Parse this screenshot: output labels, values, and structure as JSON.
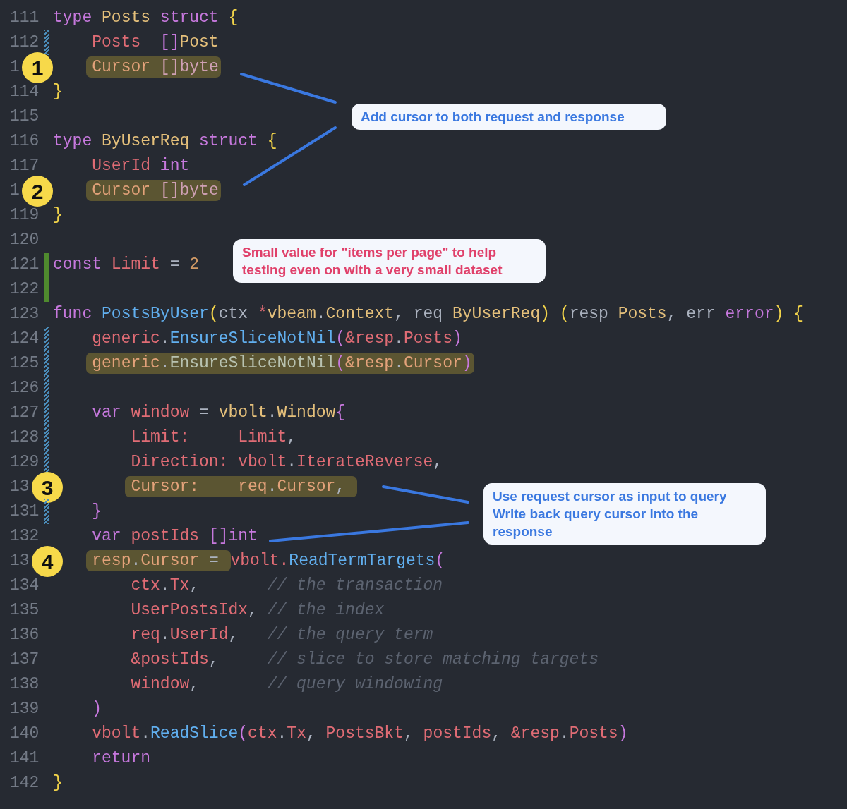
{
  "editor": {
    "lines": [
      {
        "number": "111",
        "modified": false,
        "added": false,
        "before": [
          {
            "t": "type",
            "kind": "kw"
          },
          {
            "t": " Posts",
            "kind": "type"
          },
          {
            "t": " struct",
            "kind": "kw"
          },
          {
            "t": " {",
            "kind": "brace"
          }
        ]
      },
      {
        "number": "112",
        "modified": true,
        "added": false,
        "before": [
          {
            "t": "    Posts",
            "kind": "field"
          },
          {
            "t": "  []",
            "kind": "kw"
          },
          {
            "t": "Post",
            "kind": "type"
          }
        ]
      },
      {
        "number": "1",
        "modified": false,
        "added": false,
        "badge": "1",
        "highlight": [
          {
            "t": "    Cursor",
            "kind": "field"
          },
          {
            "t": " []",
            "kind": "kw"
          },
          {
            "t": "byte",
            "kind": "kw"
          }
        ]
      },
      {
        "number": "114",
        "modified": false,
        "added": false,
        "before": [
          {
            "t": "}",
            "kind": "brace"
          }
        ]
      },
      {
        "number": "115",
        "modified": false,
        "added": false
      },
      {
        "number": "116",
        "modified": false,
        "added": false,
        "before": [
          {
            "t": "type",
            "kind": "kw"
          },
          {
            "t": " ByUserReq",
            "kind": "type"
          },
          {
            "t": " struct",
            "kind": "kw"
          },
          {
            "t": " {",
            "kind": "brace"
          }
        ]
      },
      {
        "number": "117",
        "modified": false,
        "added": false,
        "before": [
          {
            "t": "    UserId",
            "kind": "field"
          },
          {
            "t": " int",
            "kind": "kw"
          }
        ]
      },
      {
        "number": "1",
        "modified": false,
        "added": false,
        "badge": "2",
        "highlight": [
          {
            "t": "    Cursor",
            "kind": "field"
          },
          {
            "t": " []",
            "kind": "kw"
          },
          {
            "t": "byte",
            "kind": "kw"
          }
        ]
      },
      {
        "number": "119",
        "modified": false,
        "added": false,
        "before": [
          {
            "t": "}",
            "kind": "brace"
          }
        ]
      },
      {
        "number": "120",
        "modified": false,
        "added": false
      },
      {
        "number": "121",
        "modified": false,
        "added": true,
        "before": [
          {
            "t": "const",
            "kind": "kw"
          },
          {
            "t": " Limit",
            "kind": "field"
          },
          {
            "t": " = "
          },
          {
            "t": "2",
            "kind": "num"
          }
        ]
      },
      {
        "number": "122",
        "modified": false,
        "added": true
      },
      {
        "number": "123",
        "modified": false,
        "added": false,
        "before": [
          {
            "t": "func",
            "kind": "kw"
          },
          {
            "t": " PostsByUser",
            "kind": "fn"
          },
          {
            "t": "(",
            "kind": "brace"
          },
          {
            "t": "ctx "
          },
          {
            "t": "*",
            "kind": "field"
          },
          {
            "t": "vbeam",
            "kind": "type"
          },
          {
            "t": "."
          },
          {
            "t": "Context",
            "kind": "type"
          },
          {
            "t": ", req "
          },
          {
            "t": "ByUserReq",
            "kind": "type"
          },
          {
            "t": ")",
            "kind": "brace"
          },
          {
            "t": " (",
            "kind": "brace"
          },
          {
            "t": "resp "
          },
          {
            "t": "Posts",
            "kind": "type"
          },
          {
            "t": ", err "
          },
          {
            "t": "error",
            "kind": "kw"
          },
          {
            "t": ")",
            "kind": "brace"
          },
          {
            "t": " {",
            "kind": "brace"
          }
        ]
      },
      {
        "number": "124",
        "modified": true,
        "added": false,
        "before": [
          {
            "t": "    generic",
            "kind": "field"
          },
          {
            "t": "."
          },
          {
            "t": "EnsureSliceNotNil",
            "kind": "fn"
          },
          {
            "t": "(",
            "kind": "paren"
          },
          {
            "t": "&resp",
            "kind": "field"
          },
          {
            "t": "."
          },
          {
            "t": "Posts",
            "kind": "field"
          },
          {
            "t": ")",
            "kind": "paren"
          }
        ]
      },
      {
        "number": "125",
        "modified": true,
        "added": false,
        "highlight": [
          {
            "t": "    generic",
            "kind": "field"
          },
          {
            "t": "."
          },
          {
            "t": "EnsureSliceNotNil",
            "kind": "fn"
          },
          {
            "t": "(",
            "kind": "paren"
          },
          {
            "t": "&resp",
            "kind": "field"
          },
          {
            "t": "."
          },
          {
            "t": "Cursor",
            "kind": "field"
          },
          {
            "t": ")",
            "kind": "paren"
          }
        ]
      },
      {
        "number": "126",
        "modified": true,
        "added": false
      },
      {
        "number": "127",
        "modified": true,
        "added": false,
        "before": [
          {
            "t": "    var",
            "kind": "kw"
          },
          {
            "t": " window",
            "kind": "field"
          },
          {
            "t": " = "
          },
          {
            "t": "vbolt",
            "kind": "type"
          },
          {
            "t": "."
          },
          {
            "t": "Window",
            "kind": "type"
          },
          {
            "t": "{",
            "kind": "paren"
          }
        ]
      },
      {
        "number": "128",
        "modified": true,
        "added": false,
        "before": [
          {
            "t": "        Limit:",
            "kind": "field"
          },
          {
            "t": "     Limit",
            "kind": "field"
          },
          {
            "t": ","
          }
        ]
      },
      {
        "number": "129",
        "modified": true,
        "added": false,
        "before": [
          {
            "t": "        Direction:",
            "kind": "field"
          },
          {
            "t": " vbolt",
            "kind": "field"
          },
          {
            "t": "."
          },
          {
            "t": "IterateReverse",
            "kind": "field"
          },
          {
            "t": ","
          }
        ]
      },
      {
        "number": "13",
        "modified": false,
        "added": false,
        "badge": "3",
        "highlight": [
          {
            "t": "        Cursor:",
            "kind": "field"
          },
          {
            "t": "    req",
            "kind": "field"
          },
          {
            "t": "."
          },
          {
            "t": "Cursor",
            "kind": "field"
          },
          {
            "t": ", "
          }
        ]
      },
      {
        "number": "131",
        "modified": true,
        "added": false,
        "before": [
          {
            "t": "    }",
            "kind": "paren"
          }
        ]
      },
      {
        "number": "132",
        "modified": false,
        "added": false,
        "before": [
          {
            "t": "    var",
            "kind": "kw"
          },
          {
            "t": " postIds",
            "kind": "field"
          },
          {
            "t": " []",
            "kind": "kw"
          },
          {
            "t": "int",
            "kind": "kw"
          }
        ]
      },
      {
        "number": "13",
        "modified": false,
        "added": false,
        "badge": "4",
        "highlight": [
          {
            "t": "    resp",
            "kind": "field"
          },
          {
            "t": "."
          },
          {
            "t": "Cursor",
            "kind": "field"
          },
          {
            "t": " = "
          }
        ],
        "after": [
          {
            "t": "vbolt.",
            "kind": "field"
          },
          {
            "t": "ReadTermTargets",
            "kind": "fn"
          },
          {
            "t": "(",
            "kind": "paren"
          }
        ]
      },
      {
        "number": "134",
        "modified": false,
        "added": false,
        "before": [
          {
            "t": "        ctx",
            "kind": "field"
          },
          {
            "t": "."
          },
          {
            "t": "Tx",
            "kind": "field"
          },
          {
            "t": ","
          },
          {
            "t": "       // the transaction",
            "kind": "comment"
          }
        ]
      },
      {
        "number": "135",
        "modified": false,
        "added": false,
        "before": [
          {
            "t": "        UserPostsIdx",
            "kind": "field"
          },
          {
            "t": ","
          },
          {
            "t": " // the index",
            "kind": "comment"
          }
        ]
      },
      {
        "number": "136",
        "modified": false,
        "added": false,
        "before": [
          {
            "t": "        req",
            "kind": "field"
          },
          {
            "t": "."
          },
          {
            "t": "UserId",
            "kind": "field"
          },
          {
            "t": ","
          },
          {
            "t": "   // the query term",
            "kind": "comment"
          }
        ]
      },
      {
        "number": "137",
        "modified": false,
        "added": false,
        "before": [
          {
            "t": "        &postIds",
            "kind": "field"
          },
          {
            "t": ","
          },
          {
            "t": "     // slice to store matching targets",
            "kind": "comment"
          }
        ]
      },
      {
        "number": "138",
        "modified": false,
        "added": false,
        "before": [
          {
            "t": "        window",
            "kind": "field"
          },
          {
            "t": ","
          },
          {
            "t": "       // query windowing",
            "kind": "comment"
          }
        ]
      },
      {
        "number": "139",
        "modified": false,
        "added": false,
        "before": [
          {
            "t": "    )",
            "kind": "paren"
          }
        ]
      },
      {
        "number": "140",
        "modified": false,
        "added": false,
        "before": [
          {
            "t": "    vbolt",
            "kind": "field"
          },
          {
            "t": "."
          },
          {
            "t": "ReadSlice",
            "kind": "fn"
          },
          {
            "t": "(",
            "kind": "paren"
          },
          {
            "t": "ctx",
            "kind": "field"
          },
          {
            "t": "."
          },
          {
            "t": "Tx",
            "kind": "field"
          },
          {
            "t": ", "
          },
          {
            "t": "PostsBkt",
            "kind": "field"
          },
          {
            "t": ", "
          },
          {
            "t": "postIds",
            "kind": "field"
          },
          {
            "t": ", "
          },
          {
            "t": "&resp",
            "kind": "field"
          },
          {
            "t": "."
          },
          {
            "t": "Posts",
            "kind": "field"
          },
          {
            "t": ")",
            "kind": "paren"
          }
        ]
      },
      {
        "number": "141",
        "modified": false,
        "added": false,
        "before": [
          {
            "t": "    return",
            "kind": "kw"
          }
        ]
      },
      {
        "number": "142",
        "modified": false,
        "added": false,
        "before": [
          {
            "t": "}",
            "kind": "brace"
          }
        ]
      }
    ]
  },
  "callouts": [
    {
      "text": "Add cursor to both request and response",
      "color": "#3a78e0"
    },
    {
      "text": "Small value for \"items per page\" to help testing even on with a very small dataset",
      "color": "#e0406a"
    },
    {
      "text": "Use request cursor as input to query\nWrite back query cursor into the response",
      "color": "#3a78e0"
    }
  ]
}
